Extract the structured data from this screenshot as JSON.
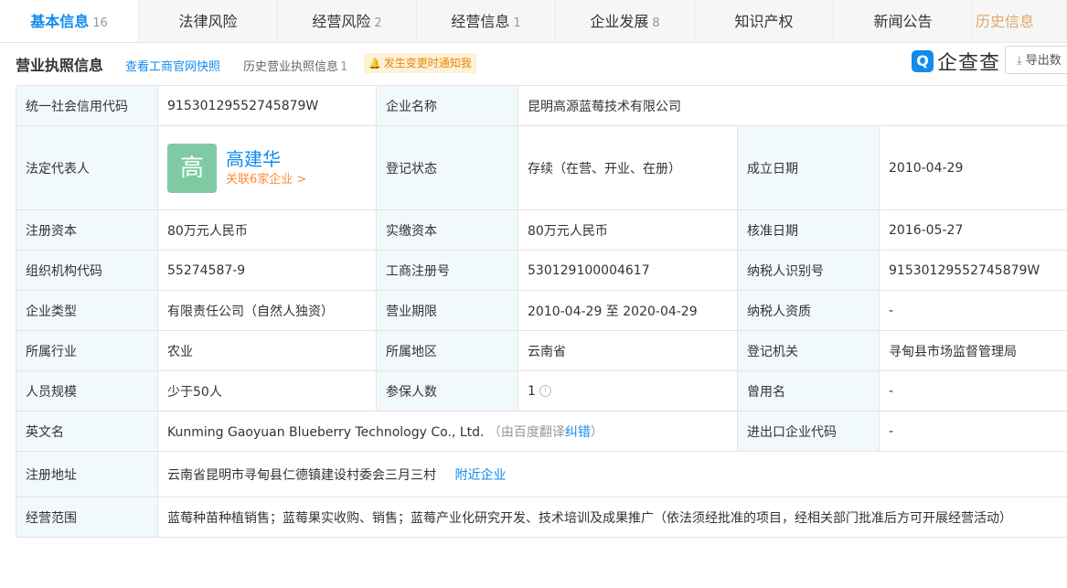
{
  "tabs": [
    {
      "label": "基本信息",
      "count": "16"
    },
    {
      "label": "法律风险",
      "count": ""
    },
    {
      "label": "经营风险",
      "count": "2"
    },
    {
      "label": "经营信息",
      "count": "1"
    },
    {
      "label": "企业发展",
      "count": "8"
    },
    {
      "label": "知识产权",
      "count": ""
    },
    {
      "label": "新闻公告",
      "count": ""
    },
    {
      "label": "历史信息",
      "count": ""
    }
  ],
  "section": {
    "title": "营业执照信息",
    "link_snapshot": "查看工商官网快照",
    "history_label": "历史营业执照信息",
    "history_count": "1",
    "notify_label": "发生变更时通知我",
    "brand": "企查查",
    "export_label": "导出数"
  },
  "rows": {
    "credit_code_label": "统一社会信用代码",
    "credit_code": "91530129552745879W",
    "company_name_label": "企业名称",
    "company_name": "昆明高源蓝莓技术有限公司",
    "legal_rep_label": "法定代表人",
    "legal_rep_avatar": "高",
    "legal_rep_name": "高建华",
    "legal_rep_related": "关联6家企业 >",
    "reg_status_label": "登记状态",
    "reg_status": "存续（在营、开业、在册）",
    "found_date_label": "成立日期",
    "found_date": "2010-04-29",
    "reg_capital_label": "注册资本",
    "reg_capital": "80万元人民币",
    "paid_capital_label": "实缴资本",
    "paid_capital": "80万元人民币",
    "approve_date_label": "核准日期",
    "approve_date": "2016-05-27",
    "org_code_label": "组织机构代码",
    "org_code": "55274587-9",
    "biz_reg_no_label": "工商注册号",
    "biz_reg_no": "530129100004617",
    "taxpayer_id_label": "纳税人识别号",
    "taxpayer_id": "91530129552745879W",
    "company_type_label": "企业类型",
    "company_type": "有限责任公司（自然人独资）",
    "biz_term_label": "营业期限",
    "biz_term": "2010-04-29 至 2020-04-29",
    "taxpayer_qual_label": "纳税人资质",
    "taxpayer_qual": "-",
    "industry_label": "所属行业",
    "industry": "农业",
    "region_label": "所属地区",
    "region": "云南省",
    "reg_authority_label": "登记机关",
    "reg_authority": "寻甸县市场监督管理局",
    "staff_size_label": "人员规模",
    "staff_size": "少于50人",
    "insured_label": "参保人数",
    "insured": "1",
    "former_name_label": "曾用名",
    "former_name": "-",
    "english_name_label": "英文名",
    "english_name": "Kunming Gaoyuan Blueberry Technology Co., Ltd.",
    "english_note_open": "（由百度翻译",
    "english_correct": "纠错",
    "english_note_close": "）",
    "import_export_label": "进出口企业代码",
    "import_export": "-",
    "address_label": "注册地址",
    "address": "云南省昆明市寻甸县仁德镇建设村委会三月三村",
    "nearby_label": "附近企业",
    "scope_label": "经营范围",
    "scope": "蓝莓种苗种植销售；蓝莓果实收购、销售；蓝莓产业化研究开发、技术培训及成果推广（依法须经批准的项目，经相关部门批准后方可开展经营活动）"
  },
  "colors": {
    "accent": "#128bed",
    "label_bg": "#f2f9fc",
    "orange": "#fd8b39",
    "avatar_bg": "#7ecba3"
  }
}
